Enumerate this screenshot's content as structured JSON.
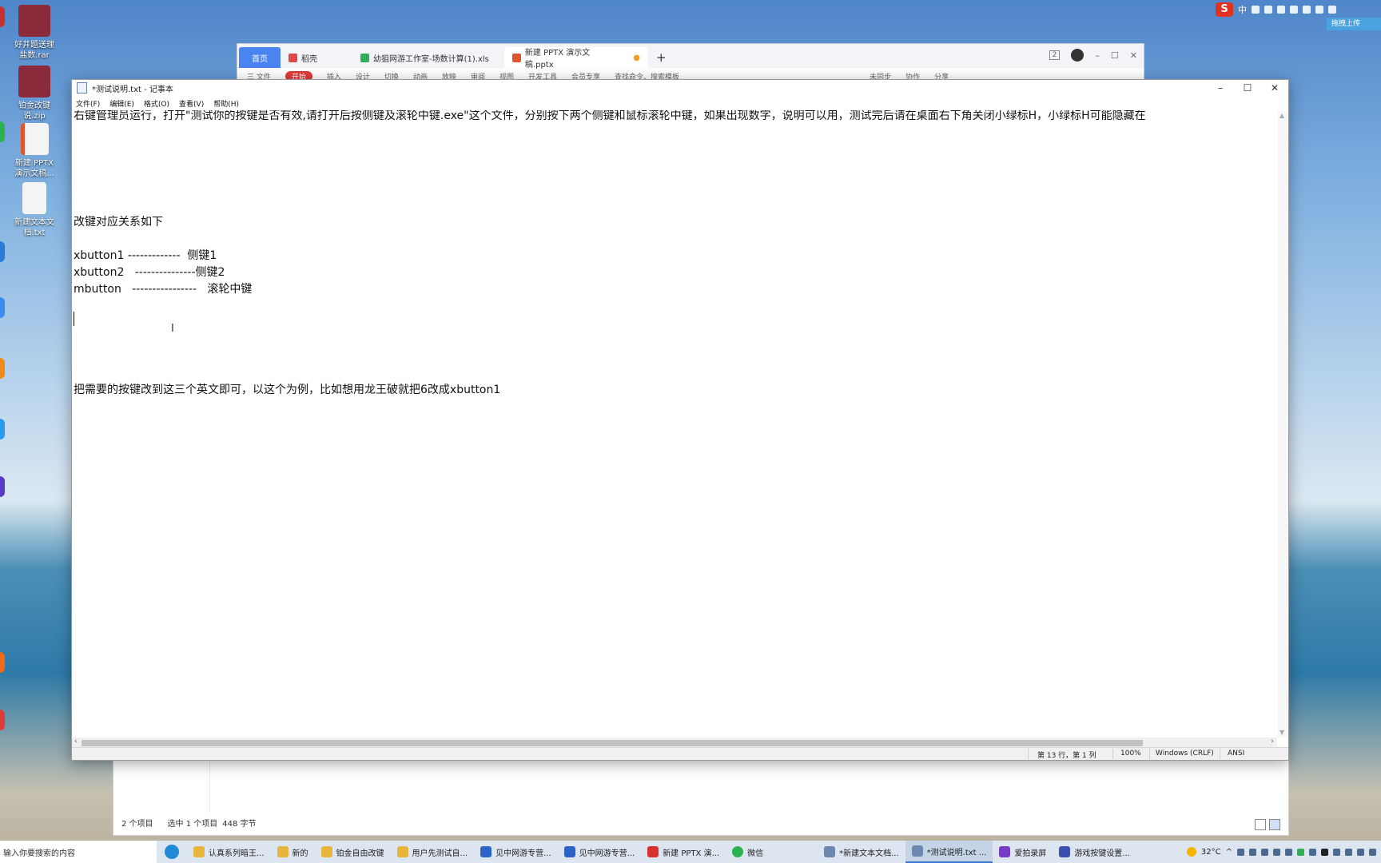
{
  "desktop": {
    "icons": [
      {
        "label": "好井题送理\n盐数.rar",
        "color": "#8a2a3a"
      },
      {
        "label": "铂金改键\n说.zip",
        "color": "#8a2a3a"
      },
      {
        "label": "新建 PPTX\n演示文稿...",
        "color": "#f4f4f4"
      },
      {
        "label": "新建文本文\n档.txt",
        "color": "#f4f4f4"
      }
    ]
  },
  "ime": {
    "logo": "S",
    "mode": "中",
    "cloud_label": "拖拽上传"
  },
  "wps": {
    "tabs": [
      {
        "label": "首页",
        "kind": "home"
      },
      {
        "label": "稻壳",
        "kind": "normal",
        "color": "#e04848"
      },
      {
        "label": "幼狙网游工作室-场数计算(1).xls",
        "kind": "normal",
        "color": "#2fae5a"
      },
      {
        "label": "新建 PPTX 演示文稿.pptx",
        "kind": "active",
        "color": "#e0552f"
      }
    ],
    "add_tab": "+",
    "ribbon": [
      "三 文件",
      "开始",
      "插入",
      "设计",
      "切换",
      "动画",
      "放映",
      "审阅",
      "视图",
      "开发工具",
      "会员专享",
      "查找命令、搜索模板"
    ],
    "ribbon_right": [
      "未同步",
      "协作",
      "分享"
    ],
    "badge": "2"
  },
  "explorer": {
    "count": "2 个项目",
    "selected": "选中 1 个项目",
    "size": "448 字节"
  },
  "notepad": {
    "title": "*测试说明.txt - 记事本",
    "menu": [
      "文件(F)",
      "编辑(E)",
      "格式(O)",
      "查看(V)",
      "帮助(H)"
    ],
    "controls": {
      "minimize": "–",
      "maximize": "☐",
      "close": "✕"
    },
    "lines": [
      "右键管理员运行，打开\"测试你的按键是否有效,请打开后按侧键及滚轮中键.exe\"这个文件，分别按下两个侧键和鼠标滚轮中键，如果出现数字，说明可以用，测试完后请在桌面右下角关闭小绿标H，小绿标H可能隐藏在",
      "改键对应关系如下",
      "xbutton1 -------------  侧键1",
      "xbutton2   ---------------侧键2",
      "mbutton   ----------------   滚轮中键",
      "把需要的按键改到这三个英文即可，以这个为例，比如想用龙王破就把6改成xbutton1"
    ],
    "status": {
      "position": "第 13 行，第 1 列",
      "zoom": "100%",
      "line_ending": "Windows (CRLF)",
      "encoding": "ANSI"
    }
  },
  "taskbar": {
    "search_placeholder": "输入你要搜索的内容",
    "apps": [
      {
        "label": "认真系列暗王...",
        "color": "#e8b53a",
        "active": false
      },
      {
        "label": "新的",
        "color": "#e8b53a",
        "active": false
      },
      {
        "label": "铂金自由改键",
        "color": "#e8b53a",
        "active": false
      },
      {
        "label": "用户先测试自...",
        "color": "#e8b53a",
        "active": false
      },
      {
        "label": "见中网游专营...",
        "color": "#2a64c8",
        "active": false
      },
      {
        "label": "见中网游专营...",
        "color": "#2a64c8",
        "active": false
      },
      {
        "label": "新建 PPTX 演...",
        "color": "#d8322f",
        "active": false
      },
      {
        "label": "微信",
        "color": "#2bb24c",
        "active": false
      },
      {
        "label": "*新建文本文档...",
        "color": "#6a88b0",
        "active": false
      },
      {
        "label": "*测试说明.txt ...",
        "color": "#6a88b0",
        "active": true
      },
      {
        "label": "爱拍录屏",
        "color": "#7a3ac8",
        "active": false
      },
      {
        "label": "游戏按键设置...",
        "color": "#3a4fb0",
        "active": false
      }
    ],
    "temperature": "32°C"
  }
}
